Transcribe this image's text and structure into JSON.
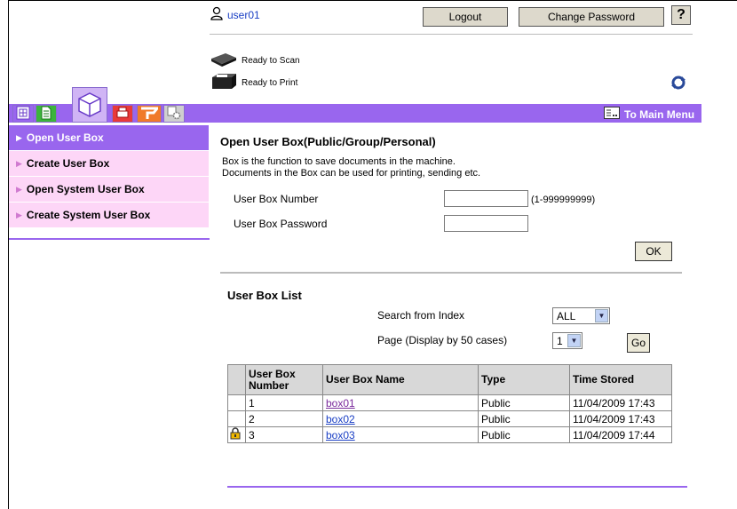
{
  "header": {
    "user_name": "user01",
    "logout_label": "Logout",
    "change_password_label": "Change Password",
    "help_label": "?"
  },
  "status": {
    "scan": "Ready to Scan",
    "print": "Ready to Print"
  },
  "menu_bar": {
    "main_menu_label": "To Main Menu"
  },
  "sidebar": {
    "items": [
      {
        "label": "Open User Box",
        "active": true
      },
      {
        "label": "Create User Box",
        "active": false
      },
      {
        "label": "Open System User Box",
        "active": false
      },
      {
        "label": "Create System User Box",
        "active": false
      }
    ]
  },
  "open_box": {
    "title": "Open User Box(Public/Group/Personal)",
    "desc_line1": "Box is the function to save documents in the machine.",
    "desc_line2": "Documents in the Box can be used for printing, sending etc.",
    "number_label": "User Box Number",
    "number_value": "",
    "number_hint": "(1-999999999)",
    "password_label": "User Box Password",
    "password_value": "",
    "ok_label": "OK"
  },
  "list": {
    "title": "User Box List",
    "search_label": "Search from Index",
    "search_value": "ALL",
    "page_label": "Page (Display by 50 cases)",
    "page_value": "1",
    "go_label": "Go",
    "columns": [
      "User Box Number",
      "User Box Name",
      "Type",
      "Time Stored"
    ],
    "rows": [
      {
        "number": "1",
        "name": "box01",
        "type": "Public",
        "time": "11/04/2009 17:43",
        "locked": false
      },
      {
        "number": "2",
        "name": "box02",
        "type": "Public",
        "time": "11/04/2009 17:43",
        "locked": false
      },
      {
        "number": "3",
        "name": "box03",
        "type": "Public",
        "time": "11/04/2009 17:44",
        "locked": true
      }
    ]
  },
  "colors": {
    "accent": "#9966ee",
    "sidebar_bg": "#fdd6f7",
    "link": "#1a3fc4"
  }
}
